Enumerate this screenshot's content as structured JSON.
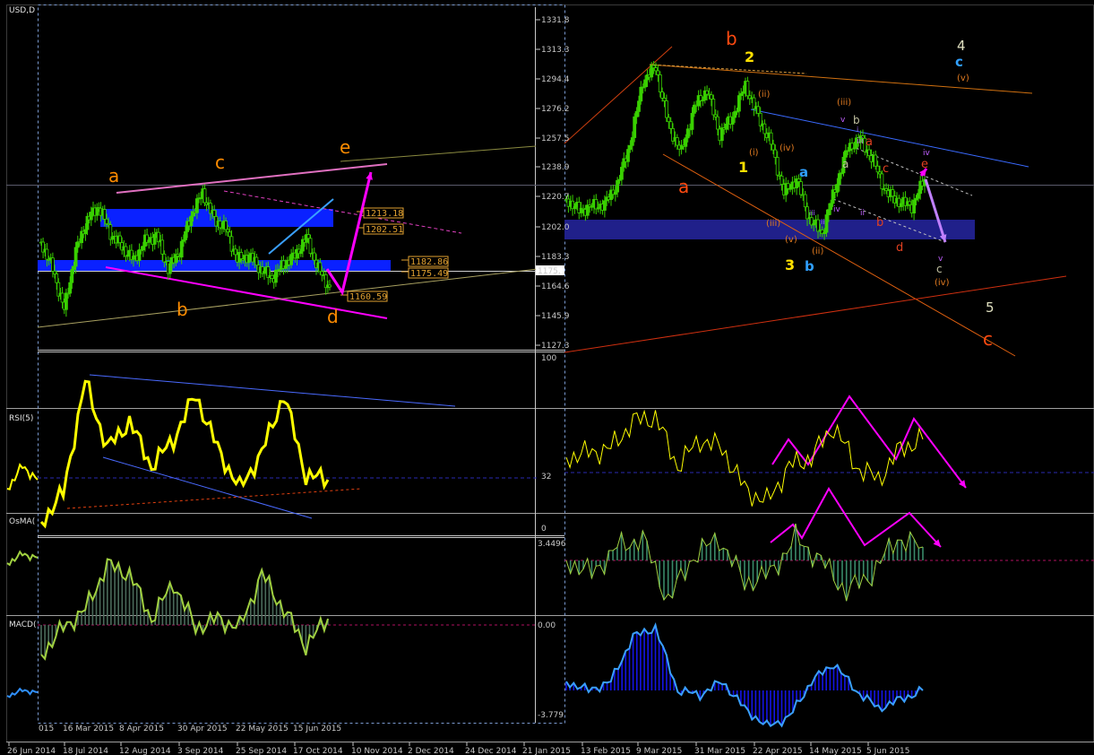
{
  "symbol_label": "USD,D",
  "subwindows": {
    "rsi": "RSI(5)",
    "osma": "OsMA(",
    "macd": "MACD("
  },
  "main_scale": [
    "1331.8",
    "1313.3",
    "1294.4",
    "1276.2",
    "1257.5",
    "1238.9",
    "1220.7",
    "1202.0",
    "1183.3",
    "1164.6",
    "1145.9",
    "1127.3"
  ],
  "current_price": "1175.",
  "rsi_scale": [
    "100",
    "32",
    "0"
  ],
  "osma_scale": [
    "3.4496"
  ],
  "macd_scale": [
    "0.00",
    "-3.779"
  ],
  "time_axis": [
    "26 Jun 2014",
    "18 Jul 2014",
    "12 Aug 2014",
    "3 Sep 2014",
    "25 Sep 2014",
    "17 Oct 2014",
    "10 Nov 2014",
    "2 Dec 2014",
    "24 Dec 2014",
    "21 Jan 2015",
    "13 Feb 2015",
    "9 Mar 2015",
    "31 Mar 2015",
    "22 Apr 2015",
    "14 May 2015",
    "5 Jun 2015"
  ],
  "overlay_time_axis": [
    "015",
    "16 Mar 2015",
    "8 Apr 2015",
    "30 Apr 2015",
    "22 May 2015",
    "15 Jun 2015"
  ],
  "price_tags": [
    "1213.18",
    "1202.51",
    "1182.86",
    "1175.49",
    "1160.59"
  ],
  "left_wave_labels": [
    "a",
    "c",
    "e",
    "b",
    "d"
  ],
  "right_wave_labels": {
    "orange_major": [
      "b",
      "a",
      "c"
    ],
    "white_major": [
      "4",
      "5"
    ],
    "yellow": [
      "2",
      "1",
      "3"
    ],
    "cyan": [
      "c",
      "a",
      "b"
    ],
    "orange_roman": [
      "(v)",
      "(ii)",
      "(i)",
      "(iv)",
      "(iii)",
      "(iii)",
      "(v)",
      "(ii)",
      "(iv)"
    ],
    "violet": [
      "v",
      "iii",
      "iv",
      "iv",
      "ii",
      "v"
    ],
    "red_small": [
      "a",
      "c",
      "b",
      "d",
      "e"
    ],
    "grey_small": [
      "b",
      "a",
      "c"
    ],
    "lilac": [
      "i",
      "ii",
      "iii"
    ]
  },
  "colors": {
    "candle": "#39d000",
    "magenta": "#ff00ff",
    "orange": "#ff8c00",
    "blue_zone": "#0a21ff",
    "rsi_line": "#ffff00",
    "osma_hist": "#3a8a6a",
    "macd_hist": "#1414e6"
  }
}
